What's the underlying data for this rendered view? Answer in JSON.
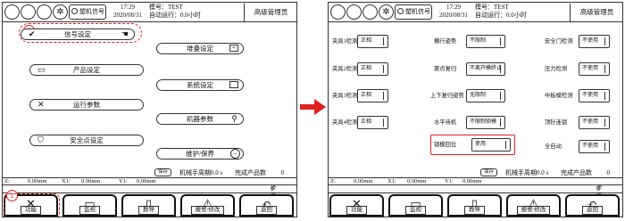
{
  "header": {
    "signal_label": "塑机信号",
    "time": "17:29",
    "date": "2020/08/31",
    "mold": "模号：TEST",
    "auto_run": "自动运行：0.0小时",
    "user": "高级管理员"
  },
  "menu": {
    "items": [
      {
        "label": "信号设定",
        "icon": "checkmark-icon"
      },
      {
        "label": "产品设定",
        "icon": "box-icon"
      },
      {
        "label": "运行参数",
        "icon": "tools-icon"
      },
      {
        "label": "安全点设定",
        "icon": "shield-icon"
      },
      {
        "label": "堆叠设定",
        "icon": "stack-icon"
      },
      {
        "label": "系统设定",
        "icon": "monitor-icon"
      },
      {
        "label": "机器参数",
        "icon": "robot-arm-icon"
      },
      {
        "label": "维护/保养",
        "icon": "minus-circle-icon"
      }
    ],
    "annotation_step2": "2",
    "annotation_step1": "1"
  },
  "status": {
    "small_btn": "保存",
    "manual_label": "机械手周期",
    "manual_value": "0.0 s",
    "qty_label": "完成产品数",
    "qty_value": "0",
    "z_label": "Z:",
    "z_value": "0.00mm",
    "x1_label": "X1:",
    "x1_value": "0.00mm",
    "y1_label": "Y1:",
    "y1_value": "0.00mm",
    "step_label": "步序",
    "step_value": "0"
  },
  "nav": {
    "tabs": [
      {
        "label": "功能",
        "icon": "tools-icon"
      },
      {
        "label": "监视",
        "icon": "monitor-icon"
      },
      {
        "label": "教导",
        "icon": "teach-icon"
      },
      {
        "label": "报警/修改",
        "icon": "alarm-icon"
      },
      {
        "label": "返回",
        "icon": "return-icon"
      }
    ]
  },
  "signals": {
    "col1": [
      {
        "label": "夹具1检测",
        "value": "正相"
      },
      {
        "label": "夹具2检测",
        "value": "正相"
      },
      {
        "label": "夹具3检测",
        "value": "正相"
      },
      {
        "label": "夹具4检测",
        "value": "正相"
      }
    ],
    "col2": [
      {
        "label": "横行姿势",
        "value": "不限制"
      },
      {
        "label": "原点复归",
        "value": "不离开模终止"
      },
      {
        "label": "上下复归姿势",
        "value": "无限制"
      },
      {
        "label": "水平待机",
        "value": "不限制锁模"
      },
      {
        "label": "锁模回位",
        "value": "使用"
      }
    ],
    "col3": [
      {
        "label": "安全门检测",
        "value": "不使用"
      },
      {
        "label": "压力检测",
        "value": "不使用"
      },
      {
        "label": "中板模检测",
        "value": "不使用"
      },
      {
        "label": "顶针连锁",
        "value": "不使用"
      },
      {
        "label": "全自动",
        "value": "不使用"
      }
    ]
  },
  "colors": {
    "highlight": "#e02020",
    "arrow": "#e02020"
  }
}
